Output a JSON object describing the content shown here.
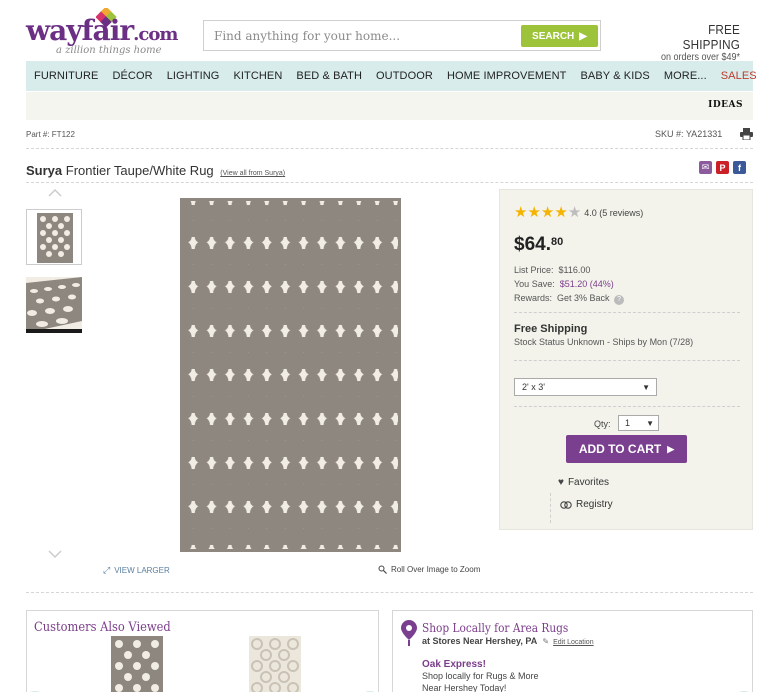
{
  "header": {
    "logo_text": "wayfair",
    "logo_suffix": ".com",
    "logo_tagline": "a zillion things home",
    "search_placeholder": "Find anything for your home...",
    "search_button": "SEARCH",
    "free_shipping_title": "FREE SHIPPING",
    "free_shipping_sub": "on orders over $49*"
  },
  "nav": {
    "items": [
      "FURNITURE",
      "DÉCOR",
      "LIGHTING",
      "KITCHEN",
      "BED & BATH",
      "OUTDOOR",
      "HOME IMPROVEMENT",
      "BABY & KIDS",
      "MORE...",
      "SALES"
    ]
  },
  "ideas": {
    "label": "IDEAS"
  },
  "product": {
    "part_number": "Part #: FT122",
    "sku": "SKU #: YA21331",
    "brand": "Surya",
    "name": "Frontier Taupe/White Rug",
    "view_all": "View all from Surya",
    "rating": 4.0,
    "rating_text": "4.0 (5 reviews)",
    "price_dollars": "$64.",
    "price_cents": "80",
    "list_price_label": "List Price:",
    "list_price": "$116.00",
    "you_save_label": "You Save:",
    "you_save": "$51.20 (44%)",
    "rewards_label": "Rewards:",
    "rewards": "Get 3% Back",
    "shipping_title": "Free Shipping",
    "stock_status": "Stock Status Unknown - Ships by Mon (7/28)",
    "size_selected": "2' x 3'",
    "qty_label": "Qty:",
    "qty_selected": "1",
    "add_to_cart": "ADD TO CART",
    "favorites": "Favorites",
    "registry": "Registry",
    "view_larger": "VIEW LARGER",
    "zoom_hint": "Roll Over Image to Zoom"
  },
  "colors": {
    "brand_purple": "#7a3f8e",
    "search_green": "#9cc33a",
    "nav_bg": "#d8ecec",
    "rug_taupe": "#8e8780",
    "rug_white": "#f1ece4",
    "star_gold": "#f5b400"
  },
  "also_viewed": {
    "title": "Customers Also Viewed"
  },
  "shop_local": {
    "title": "Shop Locally for Area Rugs",
    "subtitle": "at Stores Near Hershey, PA",
    "edit_location": "Edit Location",
    "store_name": "Oak Express!",
    "line1": "Shop locally for Rugs & More",
    "line2": "Near Hershey Today!"
  }
}
